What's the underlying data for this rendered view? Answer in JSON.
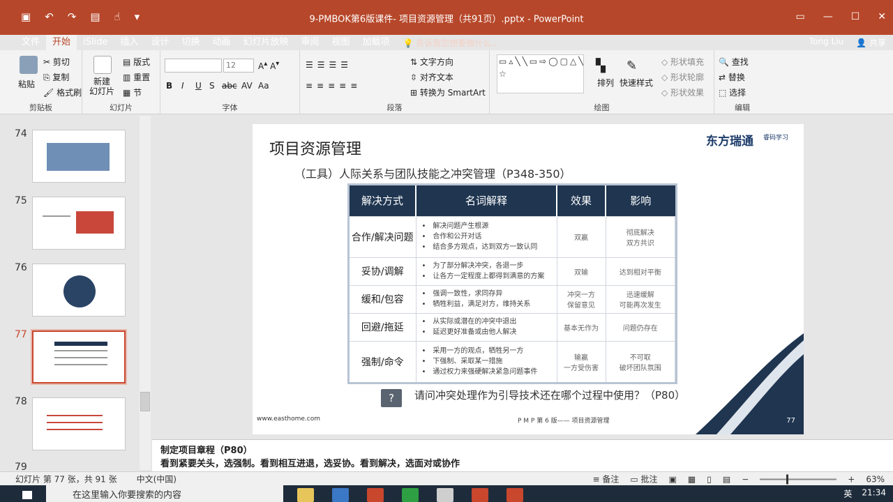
{
  "window": {
    "title": "9-PMBOK第6版课件- 项目资源管理（共91页）.pptx - PowerPoint",
    "qat_icons": [
      "save-icon",
      "undo-icon",
      "redo-icon",
      "present-icon",
      "touch-icon",
      "customize-icon"
    ],
    "controls": [
      "ribbon-display-icon",
      "minimize-icon",
      "maximize-icon",
      "close-icon"
    ]
  },
  "ribbon_tabs": [
    "文件",
    "开始",
    "iSlide",
    "插入",
    "设计",
    "切换",
    "动画",
    "幻灯片放映",
    "审阅",
    "视图",
    "加载项"
  ],
  "tell_me": "告诉我您想要做什么...",
  "account": {
    "user": "Tong Liu",
    "share": "共享"
  },
  "ribbon": {
    "clipboard": {
      "paste": "粘贴",
      "cut": "剪切",
      "copy": "复制",
      "format_painter": "格式刷",
      "label": "剪贴板"
    },
    "slides": {
      "new_slide": "新建\n幻灯片",
      "layout": "版式",
      "reset": "重置",
      "section": "节",
      "label": "幻灯片"
    },
    "font": {
      "size": "12",
      "label": "字体",
      "buttons": [
        "B",
        "I",
        "U",
        "S",
        "abc",
        "AV",
        "Aa"
      ]
    },
    "paragraph": {
      "text_direction": "文字方向",
      "align_text": "对齐文本",
      "convert_smartart": "转换为 SmartArt",
      "label": "段落"
    },
    "drawing": {
      "arrange": "排列",
      "quick_styles": "快速样式",
      "shape_fill": "形状填充",
      "shape_outline": "形状轮廓",
      "shape_effects": "形状效果",
      "label": "绘图"
    },
    "editing": {
      "find": "查找",
      "replace": "替换",
      "select": "选择",
      "label": "编辑"
    }
  },
  "thumbnails": [
    {
      "num": "74"
    },
    {
      "num": "75"
    },
    {
      "num": "76"
    },
    {
      "num": "77",
      "selected": true
    },
    {
      "num": "78"
    },
    {
      "num": "79"
    }
  ],
  "slide": {
    "title": "项目资源管理",
    "logo": "东方瑞通",
    "logo_sub": "睿码学习",
    "subtitle": "（工具）人际关系与团队技能之冲突管理（P348-350）",
    "table": {
      "headers": [
        "解决方式",
        "名词解释",
        "效果",
        "影响"
      ],
      "rows": [
        {
          "method": "合作/解决问题",
          "points": [
            "解决问题产生根源",
            "合作和公开对话",
            "结合多方观点，达到双方一致认同"
          ],
          "effect": "双赢",
          "impact": "彻底解决\n双方共识"
        },
        {
          "method": "妥协/调解",
          "points": [
            "为了部分解决冲突，各退一步",
            "让各方一定程度上都得到满意的方案"
          ],
          "effect": "双输",
          "impact": "达到相对平衡"
        },
        {
          "method": "缓和/包容",
          "points": [
            "强调一致性，求同存异",
            "牺牲利益，满足对方，维持关系"
          ],
          "effect": "冲突一方\n保留意见",
          "impact": "迅速缓解\n可能再次发生"
        },
        {
          "method": "回避/拖延",
          "points": [
            "从实际或潜在的冲突中退出",
            "延迟更好准备或由他人解决"
          ],
          "effect": "基本无作为",
          "impact": "问题仍存在"
        },
        {
          "method": "强制/命令",
          "points": [
            "采用一方的观点，牺牲另一方",
            "下强制、采取某一措施",
            "通过权力来强硬解决紧急问题事件"
          ],
          "effect": "输赢\n一方受伤害",
          "impact": "不可取\n破坏团队氛围"
        }
      ]
    },
    "question": "请问冲突处理作为引导技术还在哪个过程中使用？（P80）",
    "footer_url": "www.easthome.com",
    "footer_center": "P M P 第 6 版—— 项目资源管理",
    "page": "77"
  },
  "notes": {
    "line1": "制定项目章程（P80）",
    "line2": "看到紧要关头，选强制。看到相互进退，选妥协。看到解决，选面对或协作"
  },
  "status": {
    "slide_info": "幻灯片 第 77 张，共 91 张",
    "language": "中文(中国)",
    "notes_btn": "备注",
    "comments_btn": "批注",
    "zoom": "63%"
  },
  "taskbar": {
    "search_placeholder": "在这里输入你要搜索的内容",
    "ime": "英",
    "time": "21:34"
  }
}
